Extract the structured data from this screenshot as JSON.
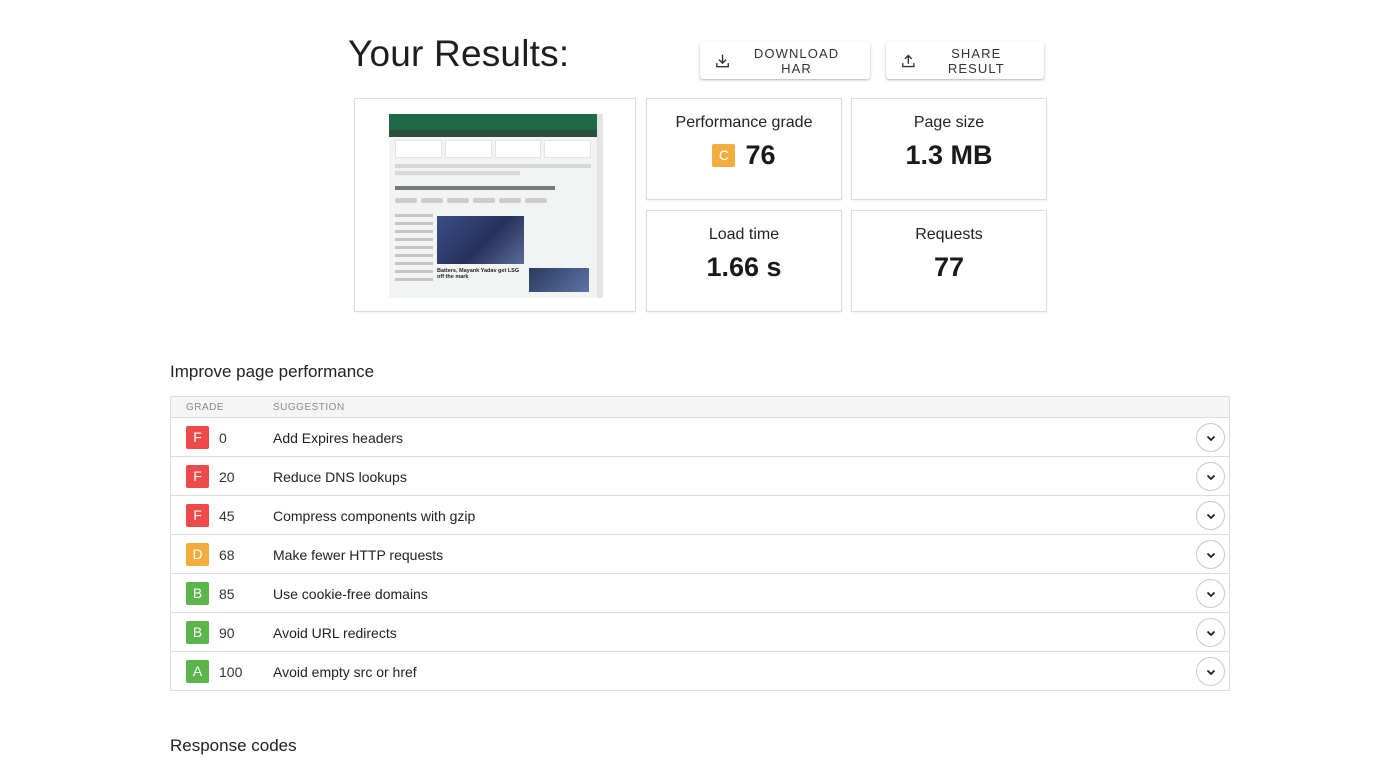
{
  "header": {
    "title": "Your Results:",
    "download_label": "DOWNLOAD HAR",
    "share_label": "SHARE RESULT"
  },
  "screenshot": {
    "thumb_headline": "Batters, Mayank Yadav get LSG off the mark"
  },
  "metrics": {
    "grade_label": "Performance grade",
    "grade_letter": "C",
    "grade_value": "76",
    "grade_color": "#f3ad3f",
    "size_label": "Page size",
    "size_value": "1.3 MB",
    "load_label": "Load time",
    "load_value": "1.66 s",
    "requests_label": "Requests",
    "requests_value": "77"
  },
  "improve": {
    "title": "Improve page performance",
    "col_grade": "GRADE",
    "col_suggestion": "SUGGESTION",
    "rows": [
      {
        "grade": "F",
        "score": "0",
        "text": "Add Expires headers",
        "color": "#ee4a4a"
      },
      {
        "grade": "F",
        "score": "20",
        "text": "Reduce DNS lookups",
        "color": "#ee4a4a"
      },
      {
        "grade": "F",
        "score": "45",
        "text": "Compress components with gzip",
        "color": "#ee4a4a"
      },
      {
        "grade": "D",
        "score": "68",
        "text": "Make fewer HTTP requests",
        "color": "#f3ad3f"
      },
      {
        "grade": "B",
        "score": "85",
        "text": "Use cookie-free domains",
        "color": "#5cb54a"
      },
      {
        "grade": "B",
        "score": "90",
        "text": "Avoid URL redirects",
        "color": "#5cb54a"
      },
      {
        "grade": "A",
        "score": "100",
        "text": "Avoid empty src or href",
        "color": "#5cb54a"
      }
    ]
  },
  "response": {
    "title": "Response codes"
  },
  "icons": {
    "download": "download-icon",
    "share": "share-icon",
    "expand": "chevron-down-icon"
  }
}
